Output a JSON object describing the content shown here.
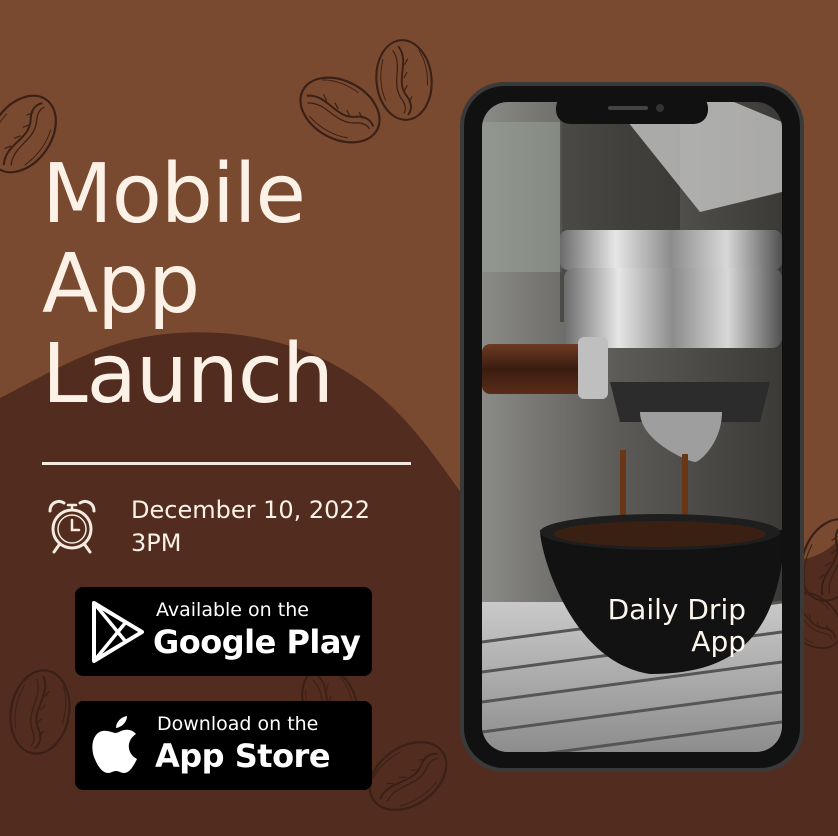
{
  "poster": {
    "headline": [
      "Mobile",
      "App",
      "Launch"
    ],
    "event": {
      "date": "December 10, 2022",
      "time": "3PM"
    },
    "badges": {
      "google_play": {
        "small": "Available on the",
        "big": "Google Play"
      },
      "app_store": {
        "small": "Download on the",
        "big": "App Store"
      }
    },
    "phone": {
      "app_name": [
        "Daily Drip",
        "App"
      ]
    }
  },
  "colors": {
    "background": "#7a4a30",
    "dark_brown": "#522c1f",
    "cream_text": "#fbf1e6",
    "badge_black": "#000000"
  },
  "icons": [
    "coffee-bean-icon",
    "alarm-clock-icon",
    "google-play-icon",
    "apple-icon"
  ]
}
